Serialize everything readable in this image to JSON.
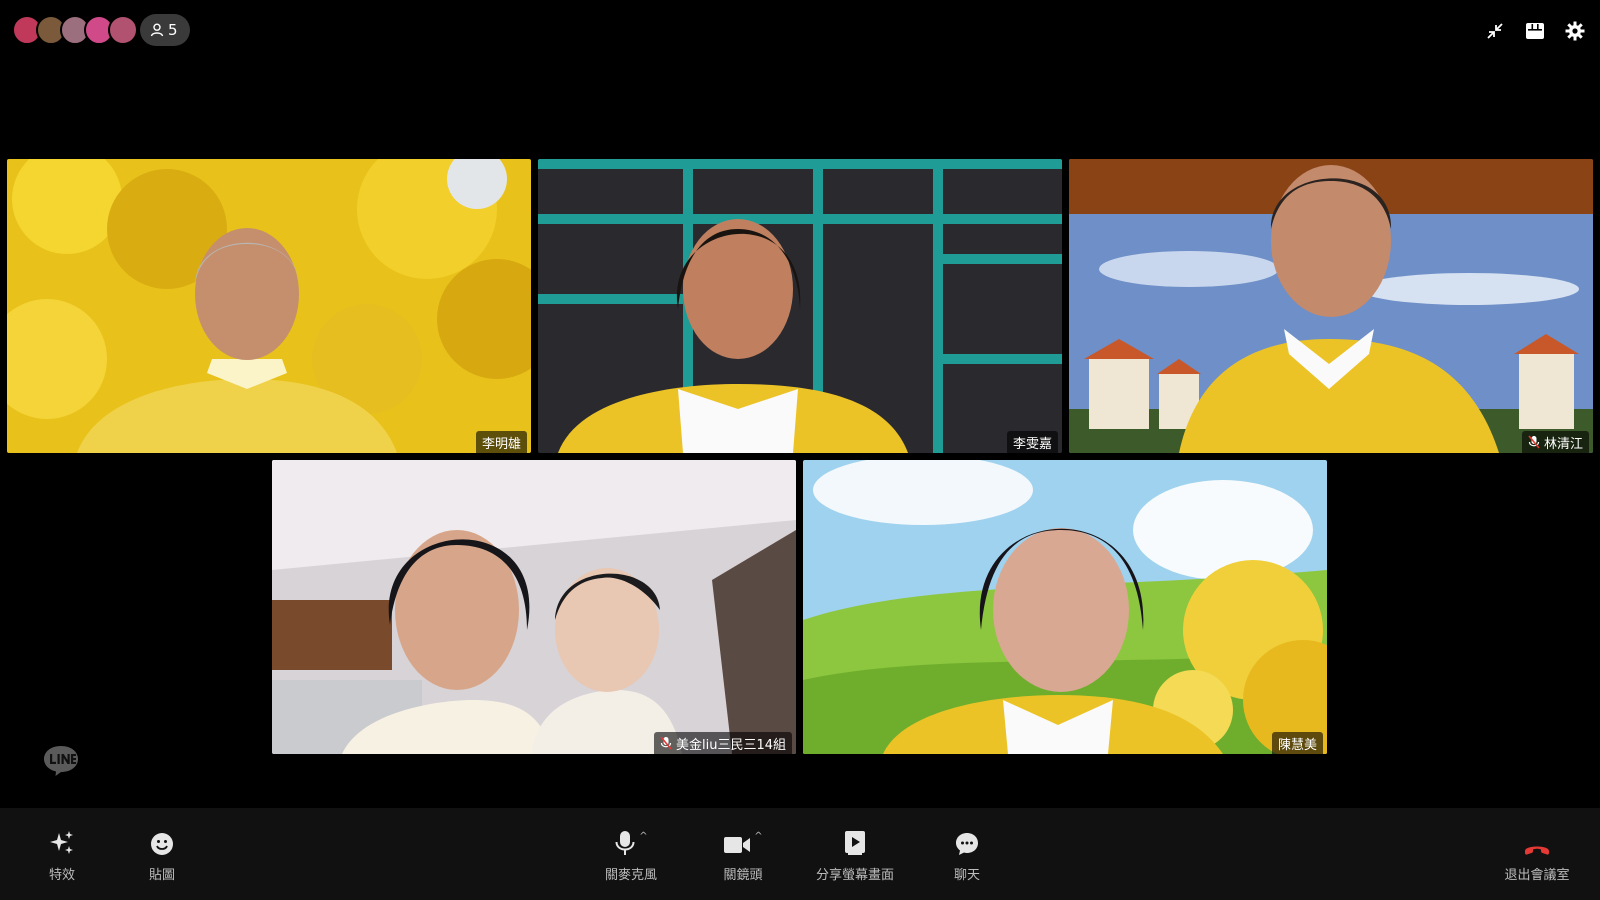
{
  "meeting": {
    "participant_count": "5",
    "avatar_colors": [
      "#c0395a",
      "#7a5a3a",
      "#9b6f7e",
      "#d04a8a",
      "#b05270"
    ]
  },
  "participants": [
    {
      "name": "李明雄",
      "muted": false
    },
    {
      "name": "李雯嘉",
      "muted": false
    },
    {
      "name": "林清江",
      "muted": true
    },
    {
      "name": "美金liu三民三14組",
      "muted": true
    },
    {
      "name": "陳慧美",
      "muted": false
    }
  ],
  "toolbar": {
    "effects": "特效",
    "stickers": "貼圖",
    "mic_off": "關麥克風",
    "camera_off": "關鏡頭",
    "share_screen": "分享螢幕畫面",
    "chat": "聊天",
    "leave": "退出會議室"
  },
  "colors": {
    "leave_red": "#e53935",
    "toolbar_bg": "#111111"
  }
}
